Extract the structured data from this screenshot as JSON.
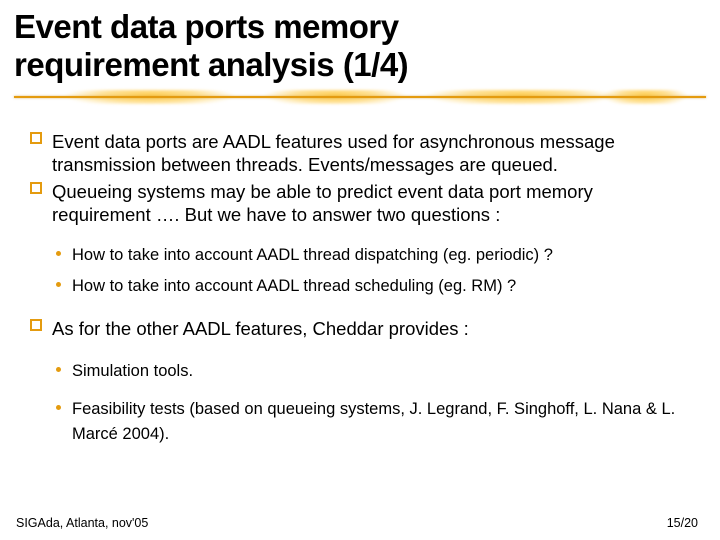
{
  "title_line1": "Event data ports memory",
  "title_line2": "requirement analysis (1/4)",
  "bullets": {
    "q1": "Event data ports are AADL features used for asynchronous message transmission between threads. Events/messages are queued.",
    "q2": "Queueing systems may be able to predict event data port memory requirement …. But we have to answer two questions :",
    "q2_sub1": "How to take into account AADL thread dispatching (eg. periodic)  ?",
    "q2_sub2": "How to take into account AADL thread scheduling (eg. RM) ?",
    "q3": "As for the other AADL features, Cheddar provides :",
    "q3_sub1": "Simulation tools.",
    "q3_sub2": "Feasibility tests (based on queueing systems, J. Legrand, F. Singhoff, L. Nana & L. Marcé 2004)."
  },
  "footer": {
    "left": "SIGAda, Atlanta, nov'05",
    "right": "15/20"
  }
}
